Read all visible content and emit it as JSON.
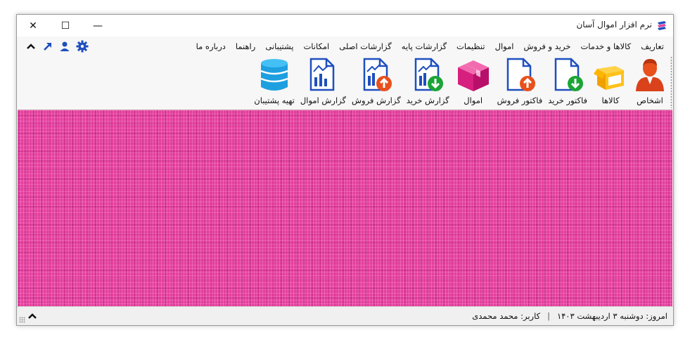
{
  "window": {
    "title": "نرم افزار اموال آسان"
  },
  "controls": {
    "minimize": "—",
    "maximize": "☐",
    "close": "✕"
  },
  "menu": [
    "تعاریف",
    "کالاها و خدمات",
    "خرید و فروش",
    "اموال",
    "تنظیمات",
    "گزارشات پایه",
    "گزارشات اصلی",
    "امکانات",
    "پشتیبانی",
    "راهنما",
    "درباره ما"
  ],
  "toolbar": {
    "persons": "اشخاص",
    "goods": "کالاها",
    "purchase_invoice": "فاکتور خرید",
    "sales_invoice": "فاکتور فروش",
    "assets": "اموال",
    "purchase_report": "گزارش خرید",
    "sales_report": "گزارش فروش",
    "assets_report": "گزارش اموال",
    "backup": "تهیه پشتیبان"
  },
  "status": {
    "today": "امروز: دوشنبه ۳ اردیبهشت ۱۴۰۳",
    "separator": "|",
    "user": "کاربر: محمد محمدی"
  },
  "colors": {
    "workspace": "#e4409c",
    "accent_blue": "#1f4fbf",
    "orange": "#e8501c",
    "green": "#1aa535"
  }
}
